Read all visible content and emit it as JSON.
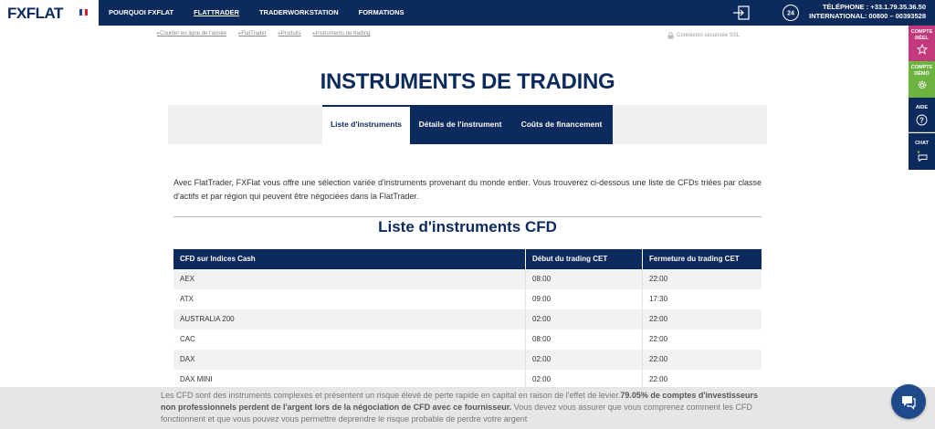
{
  "header": {
    "logo": "FXFLAT",
    "flag_colors": [
      "#1f3f99",
      "#ffffff",
      "#d8202a"
    ],
    "nav": [
      {
        "label": "POURQUOI FXFLAT",
        "active": false
      },
      {
        "label": "FLATTRADER",
        "active": true
      },
      {
        "label": "TRADERWORKSTATION",
        "active": false
      },
      {
        "label": "FORMATIONS",
        "active": false
      }
    ],
    "phone_badge": "24",
    "phone_line1": "TÉLÉPHONE : +33.1.79.35.36.50",
    "phone_line2": "INTERNATIONAL: 00800 – 00393528"
  },
  "breadcrumb": [
    "Courtier en ligne de l'année",
    "FlatTrader",
    "Produits",
    "Instruments de trading"
  ],
  "ssl_text": "Connexion sécurisée SSL",
  "page_title": "INSTRUMENTS DE TRADING",
  "tabs": [
    "Liste d'instruments",
    "Détails de l'instrument",
    "Coûts de financement"
  ],
  "intro": "Avec FlatTrader, FXFlat vous offre une sélection variée d'instruments provenant du monde entier. Vous trouverez ci-dessous une liste de CFDs triées par classe d'actifs et par région qui peuvent être négociées dans la FlatTrader.",
  "section_title": "Liste d'instruments CFD",
  "table": {
    "headers": [
      "CFD sur Indices Cash",
      "Début du trading CET",
      "Fermeture du trading CET"
    ],
    "rows": [
      [
        "AEX",
        "08:00",
        "22:00"
      ],
      [
        "ATX",
        "09:00",
        "17:30"
      ],
      [
        "AUSTRALIA 200",
        "02:00",
        "22:00"
      ],
      [
        "CAC",
        "08:00",
        "22:00"
      ],
      [
        "DAX",
        "02:00",
        "22:00"
      ],
      [
        "DAX MINI",
        "02:00",
        "22:00"
      ]
    ]
  },
  "side_buttons": [
    {
      "line1": "COMPTE",
      "line2": "RÉEL",
      "icon": "star-icon"
    },
    {
      "line1": "COMPTE",
      "line2": "DÉMO",
      "icon": "gear-icon"
    },
    {
      "line1": "AIDE",
      "line2": "",
      "icon": "question-icon"
    },
    {
      "line1": "CHAT",
      "line2": "",
      "icon": "chat-icon"
    }
  ],
  "risk_warning": {
    "part1": "Les CFD sont des instruments complexes et présentent un risque élevé de perte rapide en capital en raison de l'effet de levier.",
    "bold": "79.05% de comptes d'investisseurs non professionnels perdent de l'argent lors de la négociation de CFD avec ce fournisseur.",
    "part2": " Vous devez vous assurer que vous comprenez comment les CFD fonctionnent et que vous pouvez vous permettre deprendre le risque probable de perdre votre argent"
  },
  "colors": {
    "navy": "#0d2a5c",
    "pink": "#c33a7c",
    "green": "#6cb33f",
    "chat": "#1f4a8a"
  }
}
